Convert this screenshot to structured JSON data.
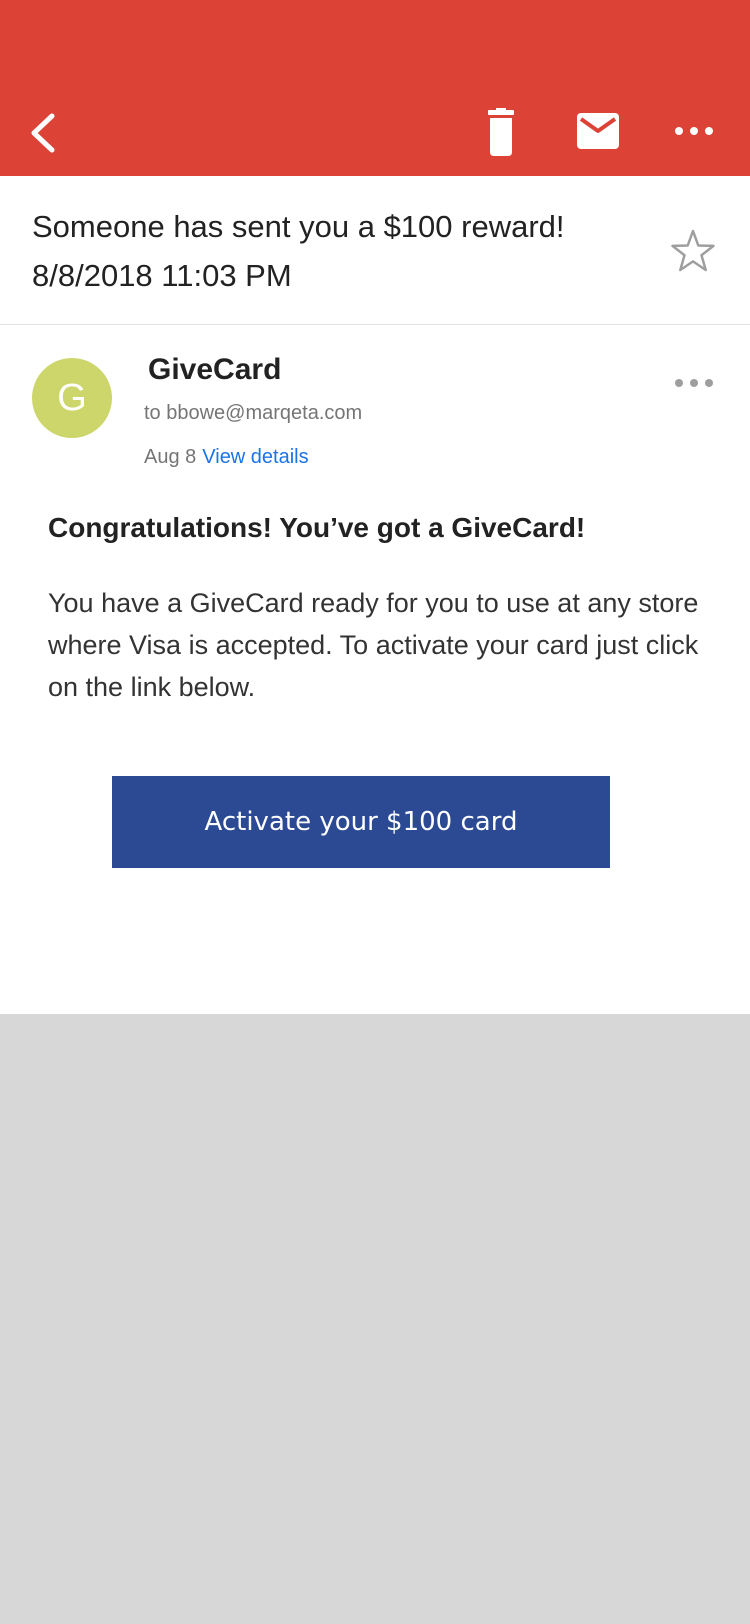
{
  "toolbar": {
    "back_icon": "chevron-left-icon",
    "delete_icon": "trash-icon",
    "mark_unread_icon": "envelope-icon",
    "more_icon": "more-horizontal-icon",
    "color": "#dc4236"
  },
  "email": {
    "subject": "Someone has sent you a $100 reward!",
    "datetime": "8/8/2018 11:03 PM",
    "star_icon": "star-outline-icon",
    "sender": {
      "avatar_letter": "G",
      "avatar_color": "#cdd66b",
      "name": "GiveCard",
      "to": "to bbowe@marqeta.com",
      "date": "Aug 8",
      "details_link": "View details"
    },
    "body": {
      "heading": "Congratulations! You’ve got a GiveCard!",
      "paragraph": "You have a GiveCard ready for you to use at any store where Visa is accepted. To activate your card just click on the link below.",
      "button_label": "Activate your $100 card",
      "button_color": "#2c4a94"
    }
  }
}
